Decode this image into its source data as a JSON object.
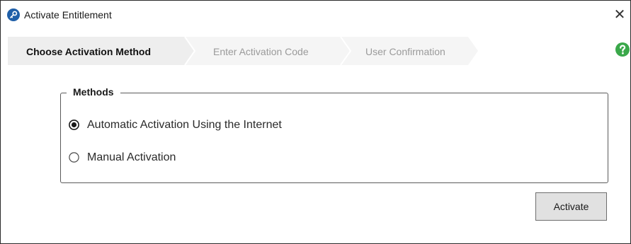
{
  "window": {
    "title": "Activate Entitlement",
    "close_glyph": "✕",
    "app_icon": "key-icon"
  },
  "wizard": {
    "steps": [
      {
        "label": "Choose Activation Method",
        "active": true
      },
      {
        "label": "Enter Activation Code",
        "active": false
      },
      {
        "label": "User Confirmation",
        "active": false
      }
    ],
    "help_icon": "question-circle-icon"
  },
  "methods": {
    "legend": "Methods",
    "options": [
      {
        "label": "Automatic Activation Using the Internet",
        "selected": true
      },
      {
        "label": "Manual Activation",
        "selected": false
      }
    ]
  },
  "actions": {
    "activate_label": "Activate"
  },
  "colors": {
    "app_icon_blue": "#1f5fa8",
    "help_green": "#3aa84a",
    "active_step_bg": "#eeeeee",
    "inactive_step_bg": "#f5f5f5"
  }
}
